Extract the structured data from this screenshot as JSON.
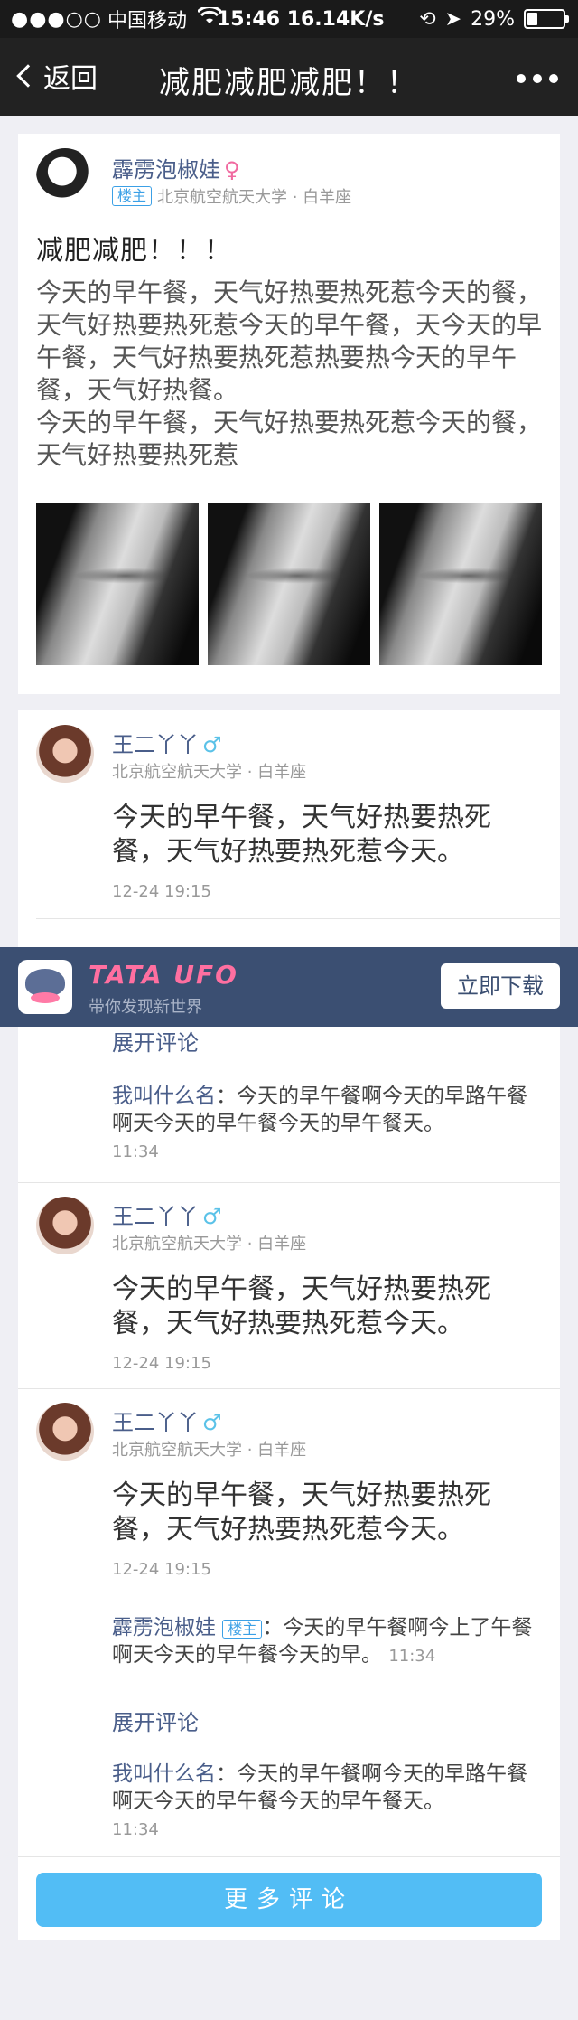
{
  "status": {
    "signal_dots": "●●●○○",
    "carrier": "中国移动",
    "time": "15:46 16.14K/s",
    "battery": "29%",
    "battery_level": 0.29
  },
  "nav": {
    "back": "返回",
    "title": "减肥减肥减肥！！"
  },
  "post": {
    "author": "霹雳泡椒娃",
    "gender": "♀",
    "badge": "楼主",
    "school": "北京航空航天大学 · 白羊座",
    "title": "减肥减肥！！！",
    "body": "今天的早午餐，天气好热要热死惹今天的餐，天气好热要热死惹今天的早午餐，天今天的早午餐，天气好热要热死惹热要热今天的早午餐，天气好热餐。\n今天的早午餐，天气好热要热死惹今天的餐，天气好热要热死惹"
  },
  "comments": [
    {
      "name": "王二丫丫",
      "gender": "♂",
      "school": "北京航空航天大学 · 白羊座",
      "body": "今天的早午餐，天气好热要热死餐，天气好热要热死惹今天。",
      "time": "12-24 19:15"
    },
    {
      "name": "王二丫丫",
      "gender": "♂",
      "school": "北京航空航天大学 · 白羊座",
      "body": "今天的早午餐，天气好热要热死餐，天气好热要热死惹今天。",
      "time": "12-24 19:15"
    },
    {
      "name": "王二丫丫",
      "gender": "♂",
      "school": "北京航空航天大学 · 白羊座",
      "body": "今天的早午餐，天气好热要热死餐，天气好热要热死惹今天。",
      "time": "12-24 19:15"
    }
  ],
  "first_thread": {
    "expand": "展开评论",
    "reply_name": "我叫什么名",
    "reply_text": "：今天的早午餐啊今天的早路午餐啊天今天的早午餐今天的早午餐天。",
    "reply_time": "11:34"
  },
  "last_thread": {
    "op_name": "霹雳泡椒娃",
    "op_badge": "楼主",
    "op_text": "：今天的早午餐啊今上了午餐啊天今天的早午餐今天的早。",
    "op_time": "11:34",
    "expand": "展开评论",
    "reply_name": "我叫什么名",
    "reply_text": "：今天的早午餐啊今天的早路午餐啊天今天的早午餐今天的早午餐天。",
    "reply_time": "11:34"
  },
  "more_comments": "更多评论",
  "banner": {
    "brand": "TATA UFO",
    "sub": "带你发现新世界",
    "download": "立即下载"
  }
}
